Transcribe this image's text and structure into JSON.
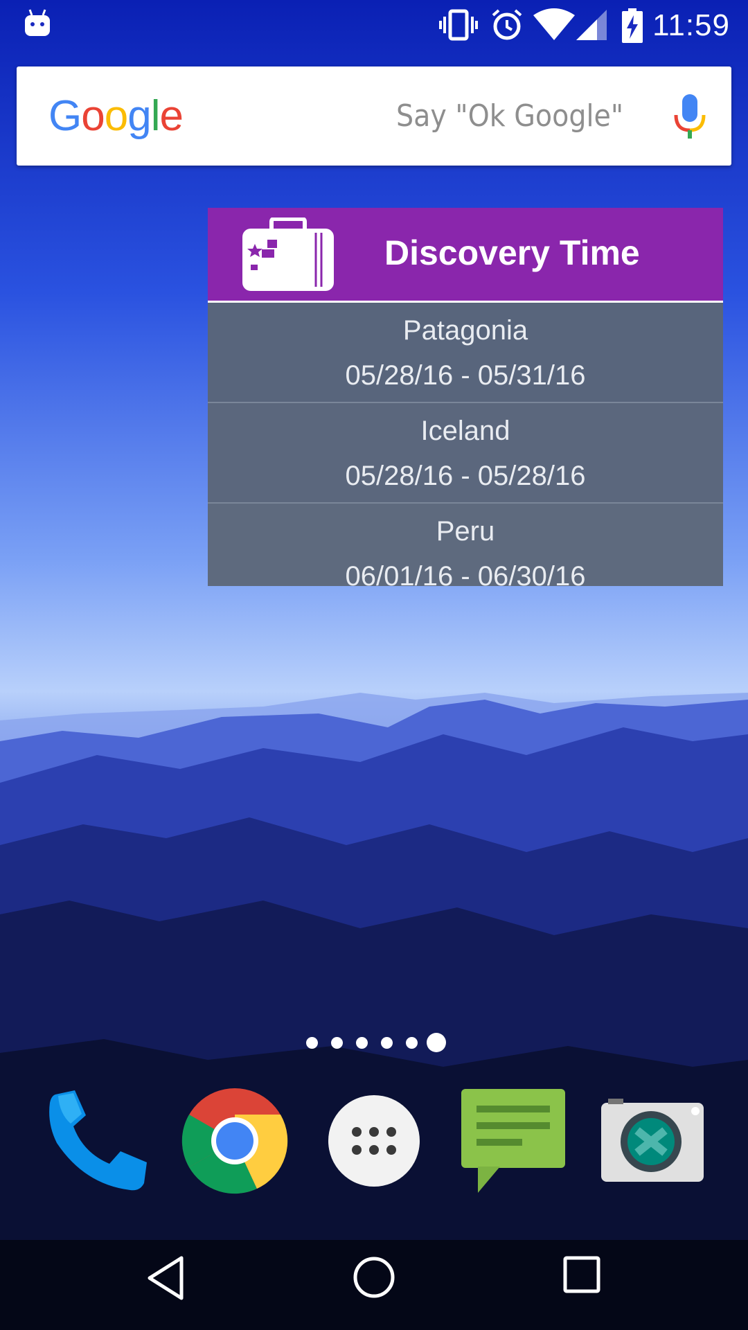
{
  "status_bar": {
    "time": "11:59",
    "icons": [
      "android-notification-icon",
      "vibrate-icon",
      "alarm-icon",
      "wifi-icon",
      "cell-signal-icon",
      "battery-charging-icon"
    ]
  },
  "search": {
    "logo_letters": [
      "G",
      "o",
      "o",
      "g",
      "l",
      "e"
    ],
    "logo_colors": [
      "#4285F4",
      "#EA4335",
      "#FBBC05",
      "#4285F4",
      "#34A853",
      "#EA4335"
    ],
    "hint": "Say \"Ok Google\"",
    "icon": "mic-icon"
  },
  "widget": {
    "title": "Discovery Time",
    "icon": "suitcase-icon",
    "header_color": "#8a26ac",
    "trips": [
      {
        "name": "Patagonia",
        "dates": "05/28/16 - 05/31/16"
      },
      {
        "name": "Iceland",
        "dates": "05/28/16 - 05/28/16"
      },
      {
        "name": "Peru",
        "dates": "06/01/16 - 06/30/16"
      }
    ]
  },
  "home": {
    "page_count": 6,
    "active_page": 6
  },
  "dock": [
    "phone-icon",
    "chrome-icon",
    "app-drawer-icon",
    "messages-icon",
    "camera-icon"
  ],
  "navigation": [
    "back-button",
    "home-button",
    "recents-button"
  ]
}
